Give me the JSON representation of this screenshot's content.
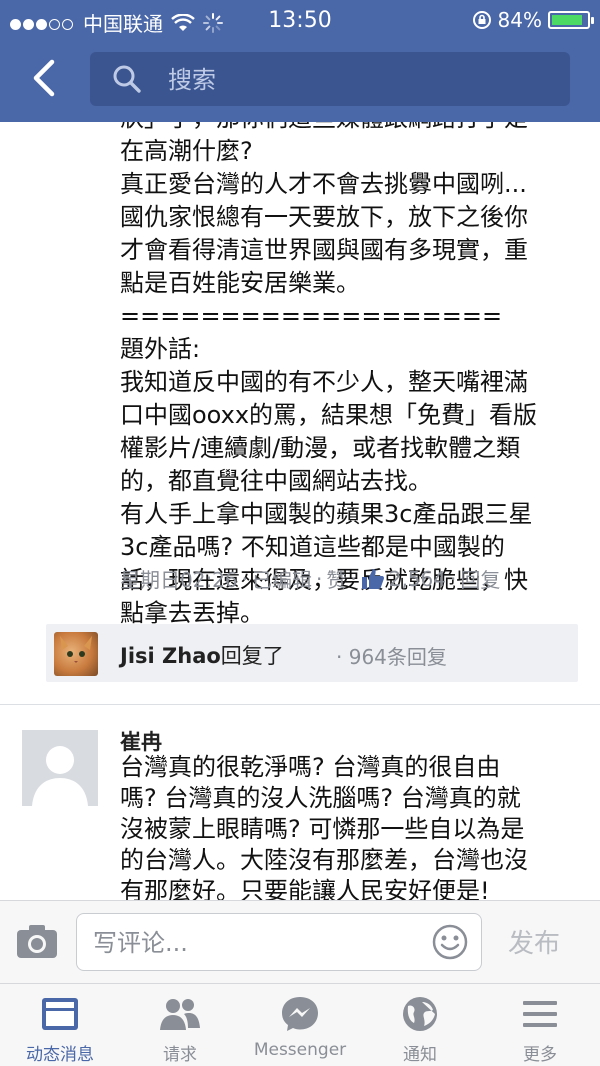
{
  "status_bar": {
    "carrier": "中国联通",
    "time": "13:50",
    "battery": "84%"
  },
  "nav": {
    "search_placeholder": "搜索"
  },
  "comment1": {
    "text_lines": "狀」了，那你們這些媒體跟網路打手是\n在高潮什麼?\n真正愛台灣的人才不會去挑釁中國咧...\n國仇家恨總有一天要放下，放下之後你\n才會看得清這世界國與國有多現實，重\n點是百姓能安居樂業。\n===================\n題外話:\n我知道反中國的有不少人，整天嘴裡滿\n口中國ooxx的罵，結果想「免費」看版\n權影片/連續劇/動漫，或者找軟體之類\n的，都直覺往中國網站去找。\n有人手上拿中國製的蘋果3c產品跟三星\n3c產品嗎? 不知道這些都是中國製的\n話，現在還來得及，要反就乾脆些，快\n點拿去丟掉。",
    "meta": {
      "time": "星期日02:26",
      "edited": "已编辑",
      "like": "赞",
      "like_count": "2,564",
      "reply": "回复",
      "sep": "·"
    }
  },
  "reply_summary": {
    "name": "Jisi Zhao",
    "action": "回复了",
    "count": "· 964条回复"
  },
  "comment2": {
    "author": "崔冉",
    "text": "台灣真的很乾淨嗎? 台灣真的很自由\n嗎? 台灣真的沒人洗腦嗎? 台灣真的就\n沒被蒙上眼睛嗎? 可憐那一些自以為是\n的台灣人。大陸沒有那麼差，台灣也沒\n有那麼好。只要能讓人民安好便是!"
  },
  "composer": {
    "placeholder": "写评论...",
    "publish": "发布"
  },
  "tabs": [
    {
      "label": "动态消息",
      "icon": "news-feed-icon",
      "active": true
    },
    {
      "label": "请求",
      "icon": "friend-requests-icon",
      "active": false
    },
    {
      "label": "Messenger",
      "icon": "messenger-icon",
      "active": false
    },
    {
      "label": "通知",
      "icon": "globe-notifications-icon",
      "active": false
    },
    {
      "label": "更多",
      "icon": "menu-icon",
      "active": false
    }
  ],
  "colors": {
    "brand": "#4a67a8",
    "inactive": "#8a8e96"
  }
}
